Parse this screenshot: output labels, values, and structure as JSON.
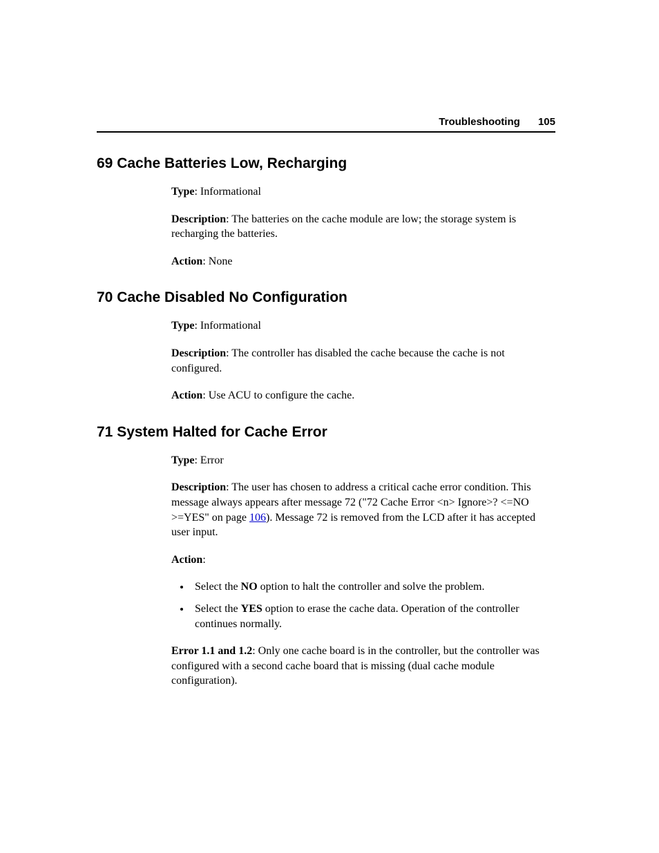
{
  "header": {
    "section": "Troubleshooting",
    "page_number": "105"
  },
  "sections": [
    {
      "heading": "69 Cache Batteries Low, Recharging",
      "type_label": "Type",
      "type_value": ": Informational",
      "desc_label": "Description",
      "desc_value": ": The batteries on the cache module are low; the storage system is recharging the batteries.",
      "action_label": "Action",
      "action_value": ": None"
    },
    {
      "heading": "70 Cache Disabled No Configuration",
      "type_label": "Type",
      "type_value": ": Informational",
      "desc_label": "Description",
      "desc_value": ": The controller has disabled the cache because the cache is not configured.",
      "action_label": "Action",
      "action_value": ": Use ACU to configure the cache."
    },
    {
      "heading": "71 System Halted for Cache Error",
      "type_label": "Type",
      "type_value": ": Error",
      "desc_label": "Description",
      "desc_pre": ": The user has chosen to address a critical cache error condition. This message always appears after message 72 (\"72 Cache Error <n> Ignore>? <=NO >=YES\" on page ",
      "desc_link": "106",
      "desc_post": "). Message 72 is removed from the LCD after it has accepted user input.",
      "action_label": "Action",
      "action_colon": ":",
      "bullets": [
        {
          "pre": "Select the ",
          "bold": "NO",
          "post": " option to halt the controller and solve the problem."
        },
        {
          "pre": "Select the ",
          "bold": "YES",
          "post": " option to erase the cache data. Operation of the controller continues normally."
        }
      ],
      "error_label": "Error 1.1 and 1.2",
      "error_value": ": Only one cache board is in the controller, but the controller was configured with a second cache board that is missing (dual cache module configuration)."
    }
  ]
}
